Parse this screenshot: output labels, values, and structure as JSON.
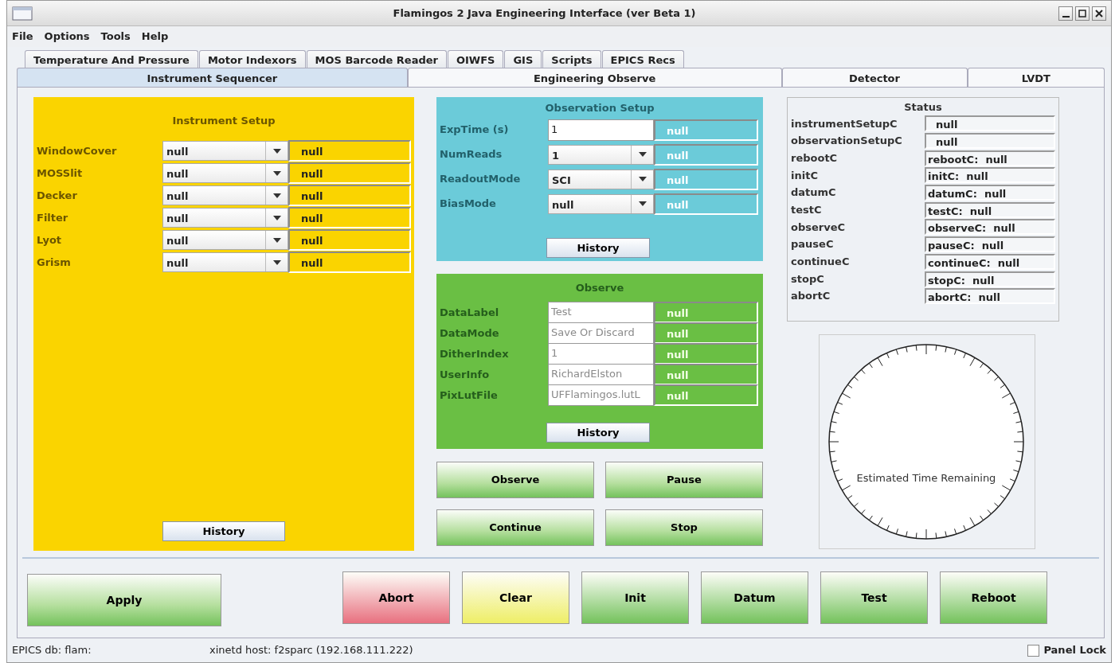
{
  "window": {
    "title": "Flamingos 2 Java Engineering Interface (ver Beta 1)"
  },
  "menu": [
    "File",
    "Options",
    "Tools",
    "Help"
  ],
  "tabs_row_1": [
    {
      "label": "Temperature And Pressure",
      "selected": false
    },
    {
      "label": "Motor Indexors",
      "selected": false
    },
    {
      "label": "MOS Barcode Reader",
      "selected": false
    },
    {
      "label": "OIWFS",
      "selected": false
    },
    {
      "label": "GIS",
      "selected": false
    },
    {
      "label": "Scripts",
      "selected": false
    },
    {
      "label": "EPICS Recs",
      "selected": false
    }
  ],
  "tabs_row_2": [
    {
      "label": "Instrument Sequencer",
      "selected": true
    },
    {
      "label": "Engineering Observe",
      "selected": false
    },
    {
      "label": "Detector",
      "selected": false
    },
    {
      "label": "LVDT",
      "selected": false
    }
  ],
  "instrument_setup": {
    "title": "Instrument Setup",
    "history_button": "History",
    "rows": [
      {
        "label": "WindowCover",
        "value": "null",
        "readback": "null"
      },
      {
        "label": "MOSSlit",
        "value": "null",
        "readback": "null"
      },
      {
        "label": "Decker",
        "value": "null",
        "readback": "null"
      },
      {
        "label": "Filter",
        "value": "null",
        "readback": "null"
      },
      {
        "label": "Lyot",
        "value": "null",
        "readback": "null"
      },
      {
        "label": "Grism",
        "value": "null",
        "readback": "null"
      }
    ]
  },
  "observation_setup": {
    "title": "Observation Setup",
    "history_button": "History",
    "rows": [
      {
        "label": "ExpTime (s)",
        "kind": "text",
        "value": "1",
        "readback": "null",
        "disabled": false
      },
      {
        "label": "NumReads",
        "kind": "combo",
        "value": "1",
        "readback": "null"
      },
      {
        "label": "ReadoutMode",
        "kind": "combo",
        "value": "SCI",
        "readback": "null"
      },
      {
        "label": "BiasMode",
        "kind": "combo",
        "value": "null",
        "readback": "null"
      }
    ]
  },
  "observe": {
    "title": "Observe",
    "history_button": "History",
    "rows": [
      {
        "label": "DataLabel",
        "kind": "text",
        "value": "Test",
        "readback": "null",
        "disabled": true
      },
      {
        "label": "DataMode",
        "kind": "text",
        "value": "Save Or Discard",
        "readback": "null",
        "disabled": true
      },
      {
        "label": "DitherIndex",
        "kind": "text",
        "value": "1",
        "readback": "null",
        "disabled": true
      },
      {
        "label": "UserInfo",
        "kind": "text",
        "value": "RichardElston",
        "readback": "null",
        "disabled": true
      },
      {
        "label": "PixLutFile",
        "kind": "text",
        "value": "UFFlamingos.lutL",
        "readback": "null",
        "disabled": true
      }
    ]
  },
  "sequence_buttons": [
    "Observe",
    "Pause",
    "Continue",
    "Stop"
  ],
  "status": {
    "title": "Status",
    "rows": [
      {
        "label": "instrumentSetupC",
        "value": "null"
      },
      {
        "label": "observationSetupC",
        "value": "null"
      },
      {
        "label": "rebootC",
        "value": "rebootC:  null"
      },
      {
        "label": "initC",
        "value": "initC:  null"
      },
      {
        "label": "datumC",
        "value": "datumC:  null"
      },
      {
        "label": "testC",
        "value": "testC:  null"
      },
      {
        "label": "observeC",
        "value": "observeC:  null"
      },
      {
        "label": "pauseC",
        "value": "pauseC:  null"
      },
      {
        "label": "continueC",
        "value": "continueC:  null"
      },
      {
        "label": "stopC",
        "value": "stopC:  null"
      },
      {
        "label": "abortC",
        "value": "abortC:  null"
      }
    ]
  },
  "timer": {
    "label": "Estimated Time Remaining"
  },
  "apply_button": "Apply",
  "action_buttons": [
    {
      "label": "Abort",
      "color": "#e8707f"
    },
    {
      "label": "Clear",
      "color": "#eeee66"
    },
    {
      "label": "Init",
      "color": "#74c25c"
    },
    {
      "label": "Datum",
      "color": "#74c25c"
    },
    {
      "label": "Test",
      "color": "#74c25c"
    },
    {
      "label": "Reboot",
      "color": "#74c25c"
    }
  ],
  "status_bar": {
    "db": "EPICS db: flam:",
    "host": "xinetd host: f2sparc (192.168.111.222)",
    "panel_lock": {
      "label": "Panel Lock",
      "checked": false
    }
  }
}
